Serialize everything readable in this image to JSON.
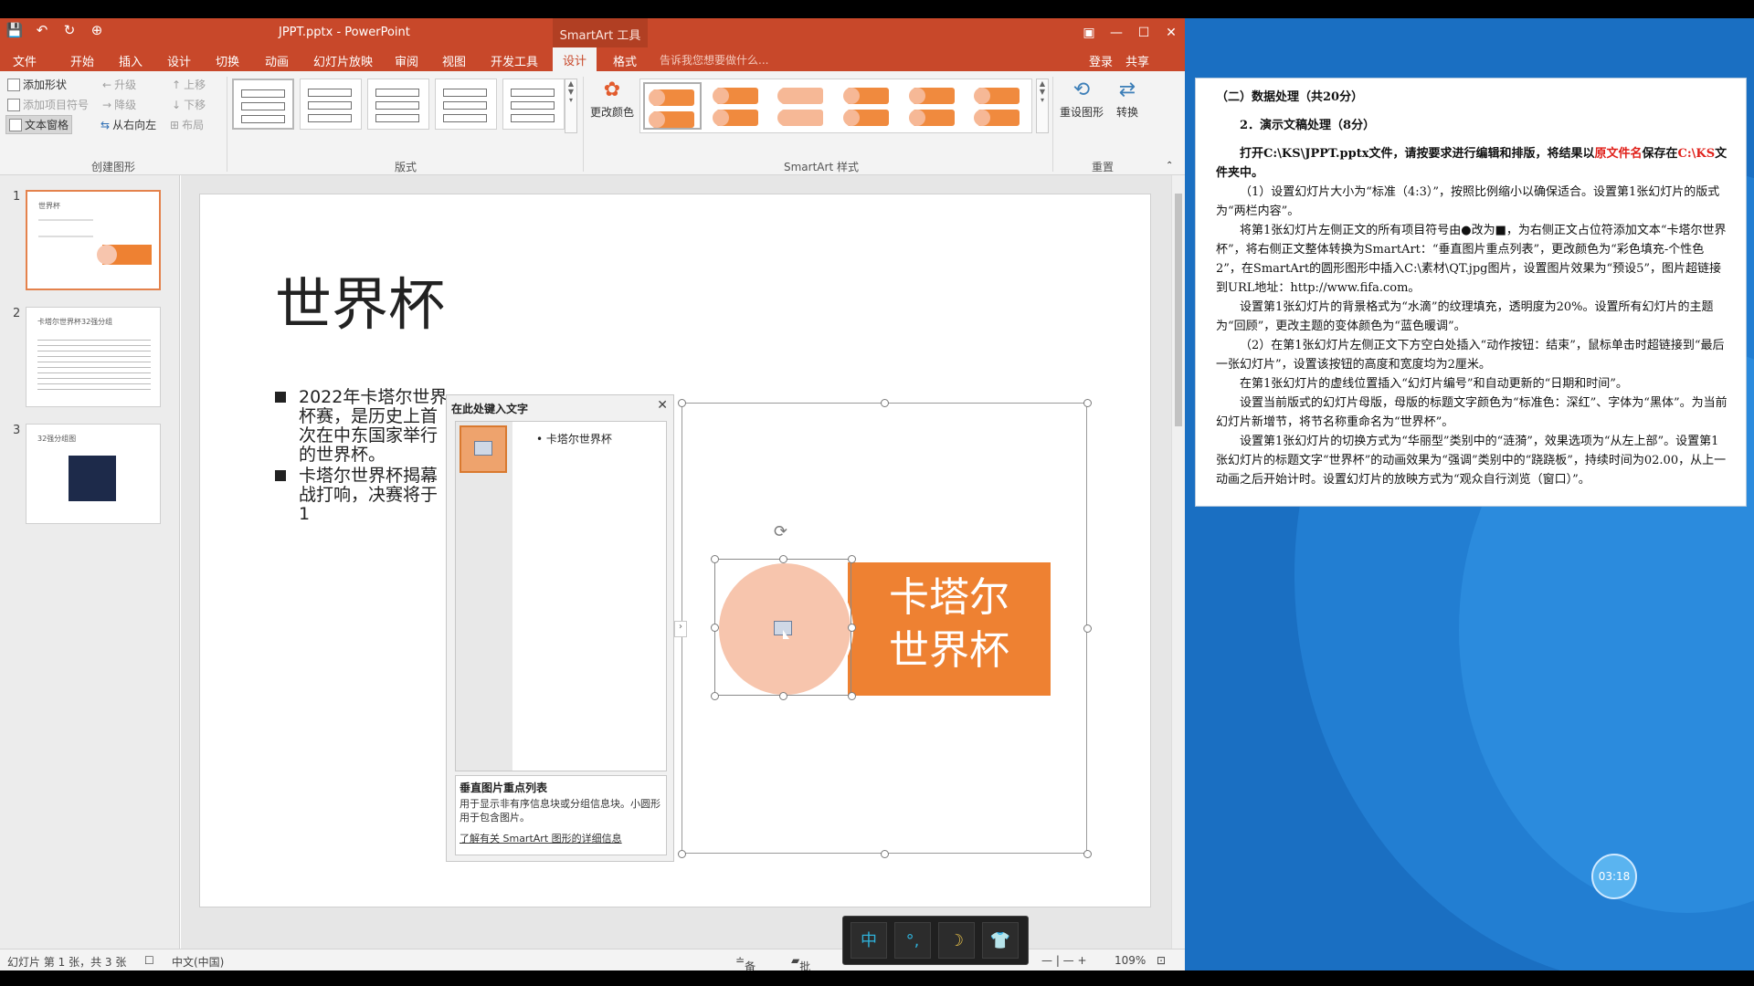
{
  "window": {
    "title": "JPPT.pptx - PowerPoint",
    "context_tab": "SmartArt 工具",
    "controls": [
      "▣",
      "—",
      "☐",
      "✕"
    ]
  },
  "qat": [
    "💾",
    "↶",
    "↻",
    "⊕"
  ],
  "tabs": [
    "文件",
    "开始",
    "插入",
    "设计",
    "切换",
    "动画",
    "幻灯片放映",
    "审阅",
    "视图",
    "开发工具",
    "设计",
    "格式"
  ],
  "active_tab": "设计",
  "tell_me": "告诉我您想要做什么...",
  "login": "登录",
  "share": "共享",
  "ribbon": {
    "create_graphic": {
      "label": "创建图形",
      "add_shape": "添加形状",
      "add_bullet": "添加项目符号",
      "text_pane": "文本窗格",
      "promote": "升级",
      "demote": "降级",
      "right_to_left": "从右向左",
      "move_up": "上移",
      "move_down": "下移",
      "layout": "布局"
    },
    "layouts_label": "版式",
    "change_colors": "更改颜色",
    "styles_label": "SmartArt 样式",
    "reset_graphic": "重设图形",
    "convert": "转换",
    "reset_label": "重置"
  },
  "thumbnails": [
    {
      "num": "1",
      "title": "世界杯"
    },
    {
      "num": "2",
      "title": "卡塔尔世界杯32强分组"
    },
    {
      "num": "3",
      "title": "32强分组图"
    }
  ],
  "slide": {
    "title": "世界杯",
    "bullet1": "2022年卡塔尔世界杯赛，是历史上首次在中东国家举行的世界杯。",
    "bullet2": "卡塔尔世界杯揭幕战打响，决赛将于1"
  },
  "text_pane": {
    "title": "在此处键入文字",
    "bullet": "卡塔尔世界杯",
    "desc_title": "垂直图片重点列表",
    "desc_body": "用于显示非有序信息块或分组信息块。小圆形用于包含图片。",
    "link": "了解有关 SmartArt 图形的详细信息"
  },
  "smartart": {
    "text": "卡塔尔世界杯",
    "line1": "卡塔尔",
    "line2": "世界杯"
  },
  "status": {
    "slide_info": "幻灯片 第 1 张，共 3 张",
    "language": "中文(中国)",
    "notes": "备注",
    "comments": "批注",
    "zoom": "109%"
  },
  "ime": [
    "中",
    "°,",
    "☽",
    "👕"
  ],
  "clock": "03:18",
  "doc": {
    "h1": "（二）数据处理（共20分）",
    "h2": "2．演示文稿处理（8分）",
    "p0a": "打开C:\\KS\\JPPT.pptx文件，请按要求进行编辑和排版，将结果以",
    "p0red": "原文件名",
    "p0b": "保存在",
    "p0path": "C:\\KS",
    "p0c": "文件夹中。",
    "p1": "（1）设置幻灯片大小为“标准（4:3）”，按照比例缩小以确保适合。设置第1张幻灯片的版式为“两栏内容”。",
    "p2": "将第1张幻灯片左侧正文的所有项目符号由●改为■，为右侧正文占位符添加文本“卡塔尔世界杯”，将右侧正文整体转换为SmartArt：“垂直图片重点列表”，更改颜色为“彩色填充-个性色2”，在SmartArt的圆形图形中插入C:\\素材\\QT.jpg图片，设置图片效果为“预设5”，图片超链接到URL地址：http://www.fifa.com。",
    "p3": "设置第1张幻灯片的背景格式为“水滴”的纹理填充，透明度为20%。设置所有幻灯片的主题为“回顾”，更改主题的变体颜色为“蓝色暖调”。",
    "p4": "（2）在第1张幻灯片左侧正文下方空白处插入“动作按钮：结束”，鼠标单击时超链接到“最后一张幻灯片”，设置该按钮的高度和宽度均为2厘米。",
    "p5": "在第1张幻灯片的虚线位置插入“幻灯片编号”和自动更新的“日期和时间”。",
    "p6": "设置当前版式的幻灯片母版，母版的标题文字颜色为“标准色：深红”、字体为“黑体”。为当前幻灯片新增节，将节名称重命名为“世界杯”。",
    "p7": "设置第1张幻灯片的切换方式为“华丽型”类别中的“涟漪”，效果选项为“从左上部”。设置第1张幻灯片的标题文字“世界杯”的动画效果为“强调”类别中的“跷跷板”，持续时间为02.00，从上一动画之后开始计时。设置幻灯片的放映方式为“观众自行浏览（窗口）”。"
  }
}
